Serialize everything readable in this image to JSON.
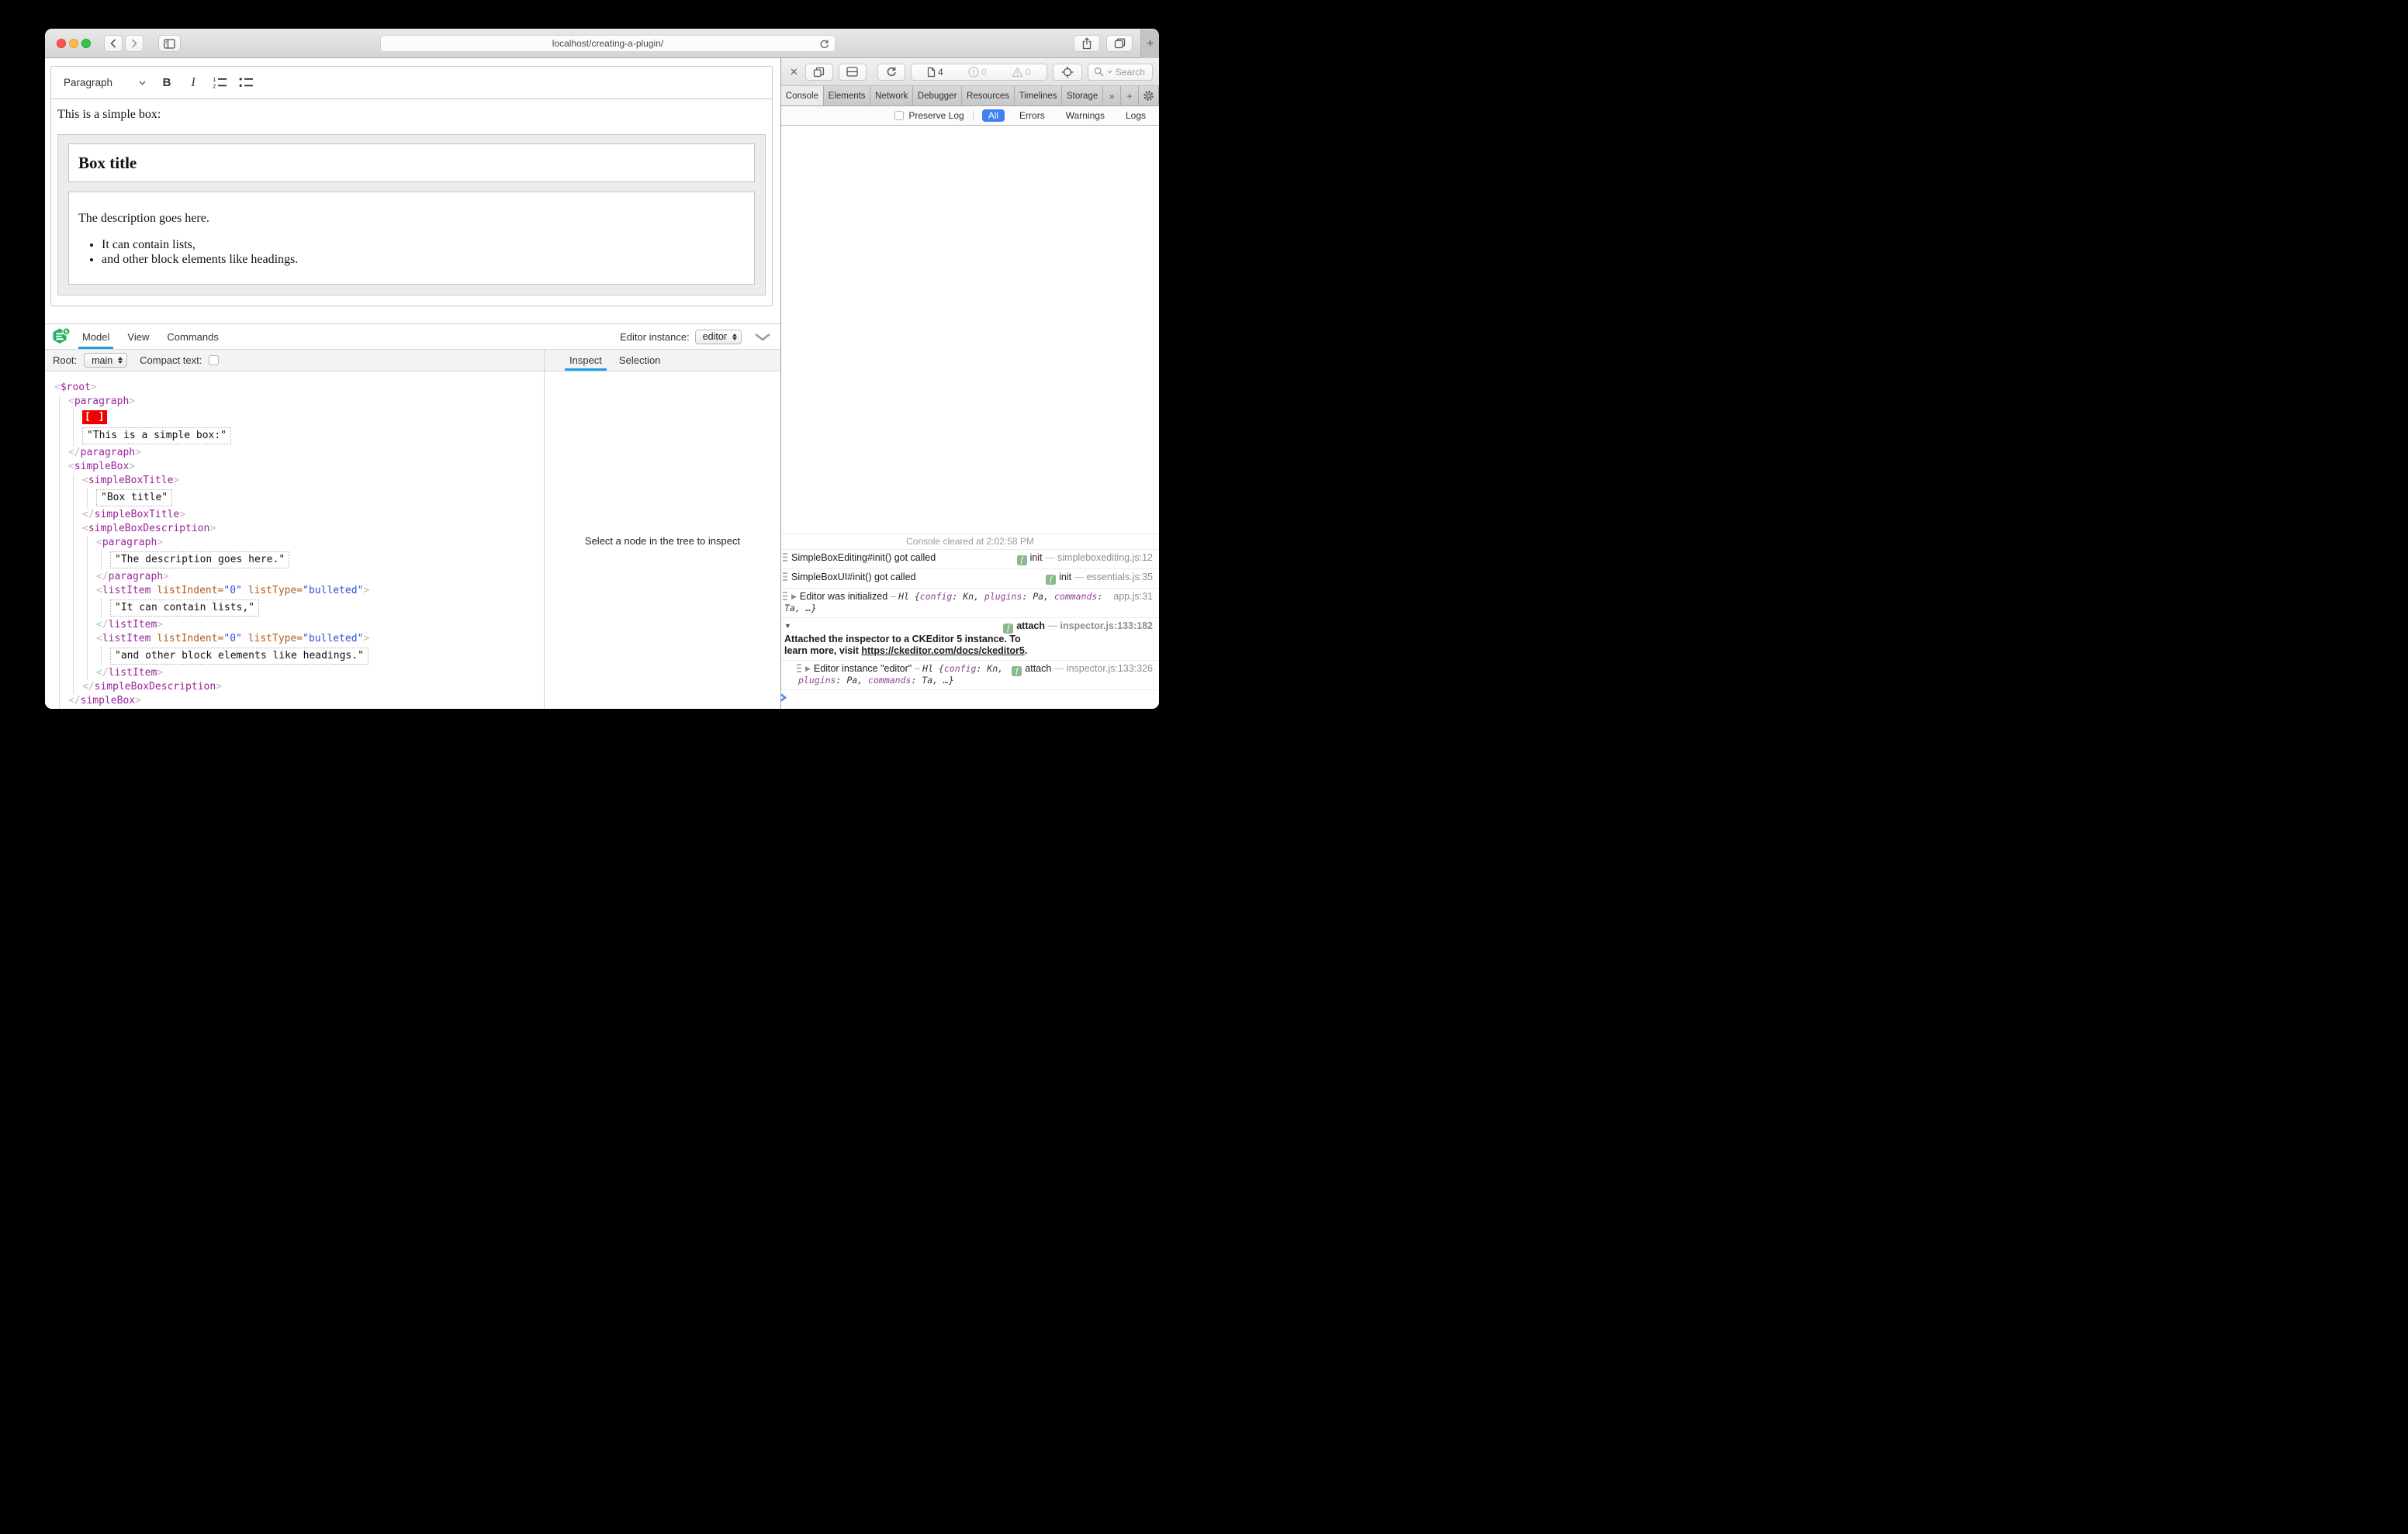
{
  "browser": {
    "url": "localhost/creating-a-plugin/",
    "new_tab_label": "+"
  },
  "editor": {
    "toolbar": {
      "block_format": "Paragraph",
      "bold": "B",
      "italic": "I"
    },
    "content": {
      "intro": "This is a simple box:",
      "box_title": "Box title",
      "description": "The description goes here.",
      "list_items": [
        "It can contain lists,",
        "and other block elements like headings."
      ]
    }
  },
  "inspector": {
    "tabs": [
      "Model",
      "View",
      "Commands"
    ],
    "active_tab": "Model",
    "editor_instance_label": "Editor instance:",
    "editor_instance_value": "editor",
    "root_label": "Root:",
    "root_value": "main",
    "compact_text_label": "Compact text:",
    "side_tabs": [
      "Inspect",
      "Selection"
    ],
    "active_side_tab": "Inspect",
    "placeholder": "Select a node in the tree to inspect",
    "tree": {
      "tag": "$root",
      "children": [
        {
          "tag": "paragraph",
          "children": [
            {
              "marker": "[ ]"
            },
            {
              "text": "\"This is a simple box:\""
            }
          ]
        },
        {
          "tag": "simpleBox",
          "children": [
            {
              "tag": "simpleBoxTitle",
              "children": [
                {
                  "text": "\"Box title\""
                }
              ]
            },
            {
              "tag": "simpleBoxDescription",
              "children": [
                {
                  "tag": "paragraph",
                  "children": [
                    {
                      "text": "\"The description goes here.\""
                    }
                  ]
                },
                {
                  "tag": "listItem",
                  "attrs": [
                    {
                      "name": "listIndent",
                      "value": "\"0\""
                    },
                    {
                      "name": "listType",
                      "value": "\"bulleted\""
                    }
                  ],
                  "children": [
                    {
                      "text": "\"It can contain lists,\""
                    }
                  ]
                },
                {
                  "tag": "listItem",
                  "attrs": [
                    {
                      "name": "listIndent",
                      "value": "\"0\""
                    },
                    {
                      "name": "listType",
                      "value": "\"bulleted\""
                    }
                  ],
                  "children": [
                    {
                      "text": "\"and other block elements like headings.\""
                    }
                  ]
                }
              ]
            }
          ]
        }
      ]
    }
  },
  "devtools": {
    "toolbar": {
      "resource_count": "4",
      "error_count": "0",
      "warning_count": "0",
      "search_placeholder": "Search"
    },
    "tabs": [
      "Console",
      "Elements",
      "Network",
      "Debugger",
      "Resources",
      "Timelines",
      "Storage"
    ],
    "active_tab": "Console",
    "more_tabs_label": "»",
    "add_tab_label": "+",
    "filter": {
      "preserve_log": "Preserve Log",
      "scopes": [
        "All",
        "Errors",
        "Warnings",
        "Logs"
      ],
      "active_scope": "All"
    },
    "console": {
      "cleared": "Console cleared at 2:02:58 PM",
      "messages": [
        {
          "icon": "log",
          "segs": [
            [
              "SimpleBoxEditing#init() got called",
              "plain"
            ]
          ],
          "fn": "init",
          "loc": "simpleboxediting.js:12"
        },
        {
          "icon": "log",
          "segs": [
            [
              "SimpleBoxUI#init() got called",
              "plain"
            ]
          ],
          "fn": "init",
          "loc": "essentials.js:35"
        },
        {
          "icon": "log",
          "arrow": "right",
          "segs": [
            [
              "Editor was initialized",
              "plain"
            ],
            [
              " – ",
              "dim"
            ],
            [
              "Hl ",
              "obj"
            ],
            [
              "{",
              "obj"
            ],
            [
              "config",
              "prop"
            ],
            [
              ": ",
              "obj"
            ],
            [
              "Kn",
              "obj"
            ],
            [
              ", ",
              "obj"
            ],
            [
              "plugins",
              "prop"
            ],
            [
              ": ",
              "obj"
            ],
            [
              "Pa",
              "obj"
            ],
            [
              ", ",
              "obj"
            ],
            [
              "commands",
              "prop"
            ],
            [
              ": ",
              "obj"
            ],
            [
              "Ta",
              "obj"
            ],
            [
              ", …}",
              "obj"
            ]
          ],
          "loc": "app.js:31"
        },
        {
          "arrow": "down",
          "bold": true,
          "segs": [
            [
              "Attached the inspector to a CKEditor 5 instance. To learn more, visit ",
              "plain"
            ],
            [
              "https://ckeditor.com/docs/ckeditor5",
              "link"
            ],
            [
              ".",
              "plain"
            ]
          ],
          "fn": "attach",
          "loc": "inspector.js:133:182"
        },
        {
          "icon": "log",
          "nested": true,
          "arrow": "right",
          "segs": [
            [
              "Editor instance \"editor\"",
              "plain"
            ],
            [
              " – ",
              "dim"
            ],
            [
              "Hl ",
              "obj"
            ],
            [
              "{",
              "obj"
            ],
            [
              "config",
              "prop"
            ],
            [
              ": ",
              "obj"
            ],
            [
              "Kn",
              "obj"
            ],
            [
              ", ",
              "obj"
            ],
            [
              "plugins",
              "prop"
            ],
            [
              ": ",
              "obj"
            ],
            [
              "Pa",
              "obj"
            ],
            [
              ", ",
              "obj"
            ],
            [
              "commands",
              "prop"
            ],
            [
              ": ",
              "obj"
            ],
            [
              "Ta",
              "obj"
            ],
            [
              ", …}",
              "obj"
            ]
          ],
          "fn": "attach",
          "loc": "inspector.js:133:326"
        }
      ]
    }
  },
  "colors": {
    "accent_blue": "#19a1e6",
    "filter_active": "#3e7ff2",
    "tag": "#9a249a",
    "attr": "#b3591c",
    "attr_value": "#2c4fd4",
    "selection_marker_bg": "#f00000",
    "badge_green": "#8bb88b",
    "logo_green": "#27b05f"
  }
}
